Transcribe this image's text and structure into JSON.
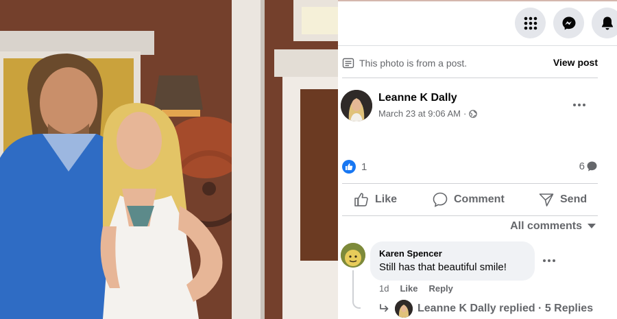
{
  "photo": {
    "alt": "",
    "colors": {
      "wall": "#7a3f2a",
      "trim": "#e8e2dc",
      "shirt": "#2f6cc4",
      "dress": "#f4f2ee",
      "hair": "#e6c66a"
    }
  },
  "top_nav": {
    "icons": [
      "apps-grid-icon",
      "messenger-icon",
      "bell-icon"
    ]
  },
  "notice": {
    "text": "This photo is from a post.",
    "link": "View post"
  },
  "post": {
    "author": "Leanne K Dally",
    "timestamp": "March 23 at 9:06 AM",
    "separator": "·",
    "audience_icon": "globe-icon"
  },
  "reactions": {
    "like_count": "1",
    "comment_count": "6"
  },
  "actions": {
    "like": "Like",
    "comment": "Comment",
    "send": "Send"
  },
  "comments": {
    "sort_label": "All comments",
    "items": [
      {
        "author": "Karen Spencer",
        "text": "Still has that beautiful smile!",
        "age": "1d",
        "like": "Like",
        "reply": "Reply",
        "replies_summary": "Leanne K Dally replied · 5 Replies"
      }
    ]
  },
  "colors": {
    "accent": "#1877f2",
    "secondary_text": "#65676b",
    "button_bg": "#e4e6eb",
    "bubble_bg": "#f0f2f5",
    "divider": "#ced0d4"
  }
}
